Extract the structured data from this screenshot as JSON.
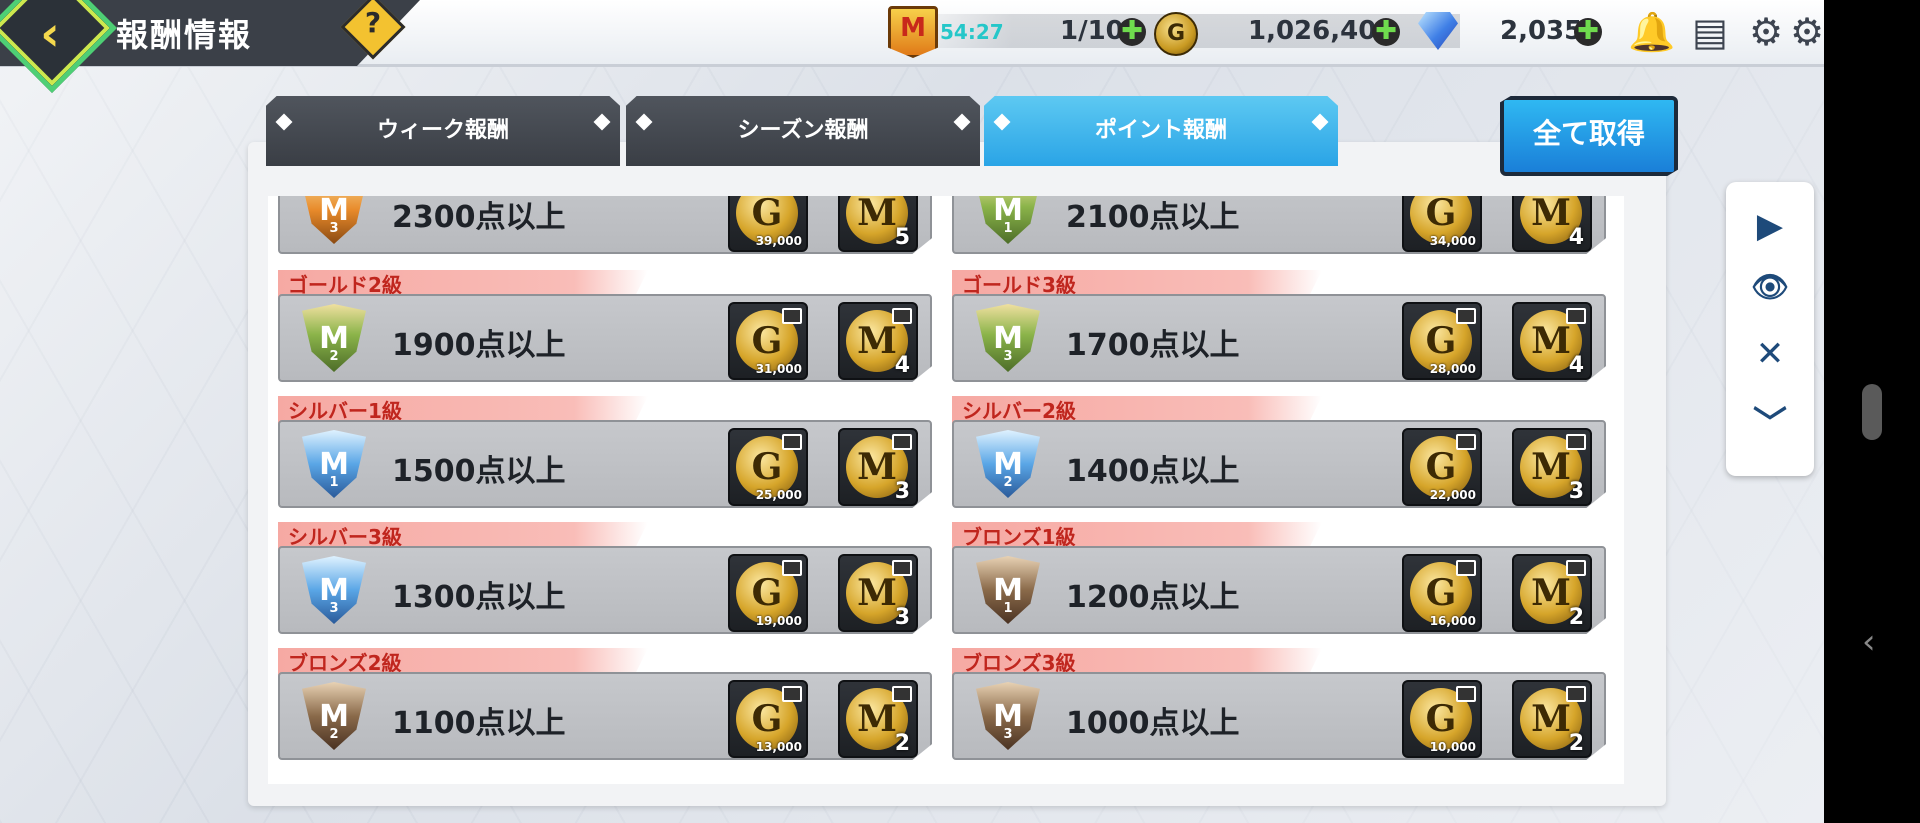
{
  "header": {
    "title": "報酬情報",
    "help_icon": "question-diamond-icon",
    "badge_letter": "M",
    "timer": "54:27",
    "stamina": "1/10",
    "coin_letter": "G",
    "gold": "1,026,408",
    "gems": "2,035",
    "plus_symbol": "✚"
  },
  "tabs": [
    {
      "label": "ウィーク報酬",
      "active": false
    },
    {
      "label": "シーズン報酬",
      "active": false
    },
    {
      "label": "ポイント報酬",
      "active": true
    }
  ],
  "get_all_label": "全て取得",
  "rewards": [
    {
      "rank": "",
      "points": "2300点以上",
      "emblem_tier": "goldorange",
      "emblem_num": "3",
      "g_amount": "39,000",
      "m_amount": "5"
    },
    {
      "rank": "",
      "points": "2100点以上",
      "emblem_tier": "gold",
      "emblem_num": "1",
      "g_amount": "34,000",
      "m_amount": "4"
    },
    {
      "rank": "ゴールド2級",
      "points": "1900点以上",
      "emblem_tier": "gold",
      "emblem_num": "2",
      "g_amount": "31,000",
      "m_amount": "4"
    },
    {
      "rank": "ゴールド3級",
      "points": "1700点以上",
      "emblem_tier": "gold",
      "emblem_num": "3",
      "g_amount": "28,000",
      "m_amount": "4"
    },
    {
      "rank": "シルバー1級",
      "points": "1500点以上",
      "emblem_tier": "silver",
      "emblem_num": "1",
      "g_amount": "25,000",
      "m_amount": "3"
    },
    {
      "rank": "シルバー2級",
      "points": "1400点以上",
      "emblem_tier": "silver",
      "emblem_num": "2",
      "g_amount": "22,000",
      "m_amount": "3"
    },
    {
      "rank": "シルバー3級",
      "points": "1300点以上",
      "emblem_tier": "silver",
      "emblem_num": "3",
      "g_amount": "19,000",
      "m_amount": "3"
    },
    {
      "rank": "ブロンズ1級",
      "points": "1200点以上",
      "emblem_tier": "bronze",
      "emblem_num": "1",
      "g_amount": "16,000",
      "m_amount": "2"
    },
    {
      "rank": "ブロンズ2級",
      "points": "1100点以上",
      "emblem_tier": "bronze",
      "emblem_num": "2",
      "g_amount": "13,000",
      "m_amount": "2"
    },
    {
      "rank": "ブロンズ3級",
      "points": "1000点以上",
      "emblem_tier": "bronze",
      "emblem_num": "3",
      "g_amount": "10,000",
      "m_amount": "2"
    }
  ],
  "side_tools": [
    {
      "name": "play-icon",
      "glyph": "▶"
    },
    {
      "name": "eye-icon",
      "glyph": "👁"
    },
    {
      "name": "close-icon",
      "glyph": "✕"
    },
    {
      "name": "chevron-down-icon",
      "glyph": "﹀"
    }
  ]
}
